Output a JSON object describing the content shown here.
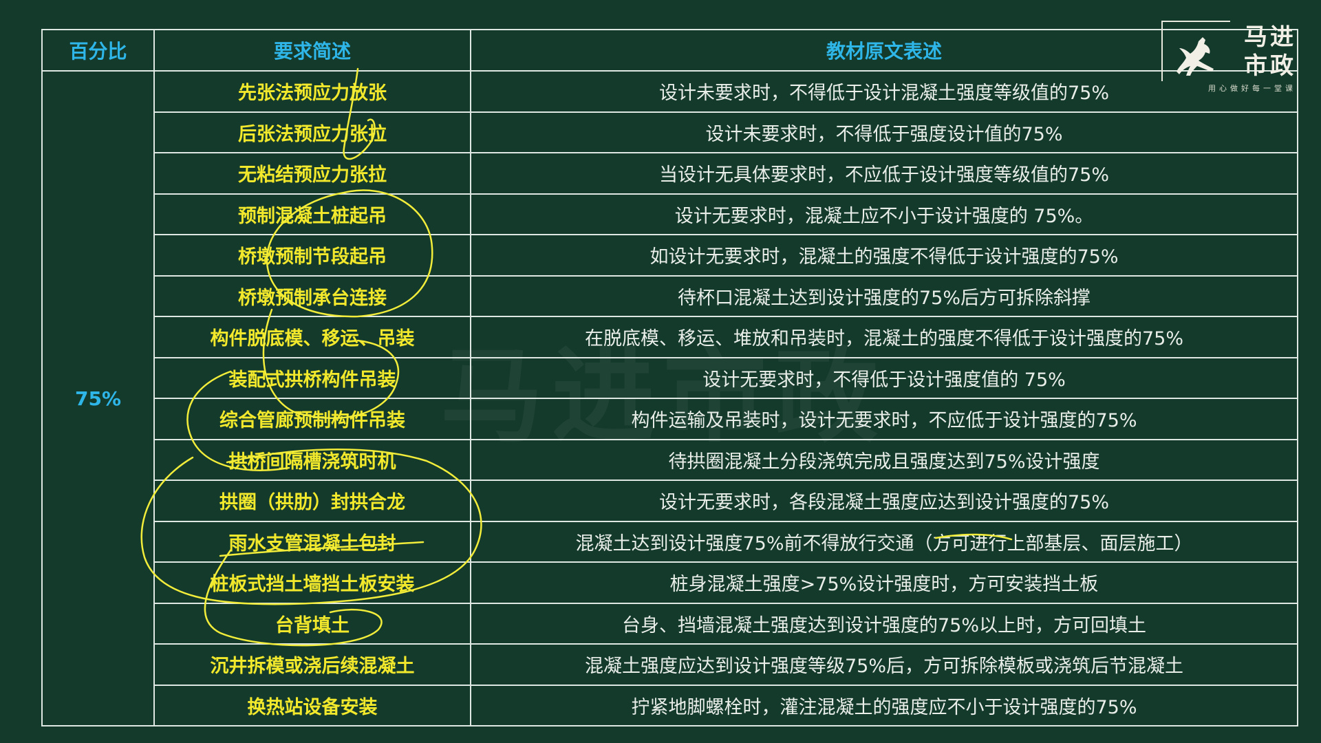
{
  "header": {
    "percent": "百分比",
    "requirement": "要求简述",
    "original": "教材原文表述"
  },
  "percent_value": "75%",
  "rows": [
    {
      "req": "先张法预应力放张",
      "orig": "设计未要求时，不得低于设计混凝土强度等级值的75%"
    },
    {
      "req": "后张法预应力张拉",
      "orig": "设计未要求时，不得低于强度设计值的75%"
    },
    {
      "req": "无粘结预应力张拉",
      "orig": "当设计无具体要求时，不应低于设计强度等级值的75%"
    },
    {
      "req": "预制混凝土桩起吊",
      "orig": "设计无要求时，混凝土应不小于设计强度的 75%。"
    },
    {
      "req": "桥墩预制节段起吊",
      "orig": "如设计无要求时，混凝土的强度不得低于设计强度的75%"
    },
    {
      "req": "桥墩预制承台连接",
      "orig": "待杯口混凝土达到设计强度的75%后方可拆除斜撑"
    },
    {
      "req": "构件脱底模、移运、吊装",
      "orig": "在脱底模、移运、堆放和吊装时，混凝土的强度不得低于设计强度的75%"
    },
    {
      "req": "装配式拱桥构件吊装",
      "orig": "设计无要求时，不得低于设计强度值的 75%"
    },
    {
      "req": "综合管廊预制构件吊装",
      "orig": "构件运输及吊装时，设计无要求时，不应低于设计强度的75%"
    },
    {
      "req": "拱桥间隔槽浇筑时机",
      "orig": "待拱圈混凝土分段浇筑完成且强度达到75%设计强度"
    },
    {
      "req": "拱圈（拱肋）封拱合龙",
      "orig": "设计无要求时，各段混凝土强度应达到设计强度的75%"
    },
    {
      "req": "雨水支管混凝土包封",
      "orig": "混凝土达到设计强度75%前不得放行交通（方可进行上部基层、面层施工）"
    },
    {
      "req": "桩板式挡土墙挡土板安装",
      "orig": "桩身混凝土强度>75%设计强度时，方可安装挡土板"
    },
    {
      "req": "台背填土",
      "orig": "台身、挡墙混凝土强度达到设计强度的75%以上时，方可回填土"
    },
    {
      "req": "沉井拆模或浇后续混凝土",
      "orig": "混凝土强度应达到设计强度等级75%后，方可拆除模板或浇筑后节混凝土"
    },
    {
      "req": "换热站设备安装",
      "orig": "拧紧地脚螺栓时，灌注混凝土的强度应不小于设计强度的75%"
    }
  ],
  "logo": {
    "line1": "马进",
    "line2": "市政",
    "slogan": "用心做好每一堂课"
  },
  "watermark": "马进市政",
  "colors": {
    "background": "#143a2c",
    "header_text": "#2fb6e8",
    "requirement_text": "#f2e92c",
    "body_text": "#e9eee9",
    "annotation": "#f2ec3a"
  }
}
